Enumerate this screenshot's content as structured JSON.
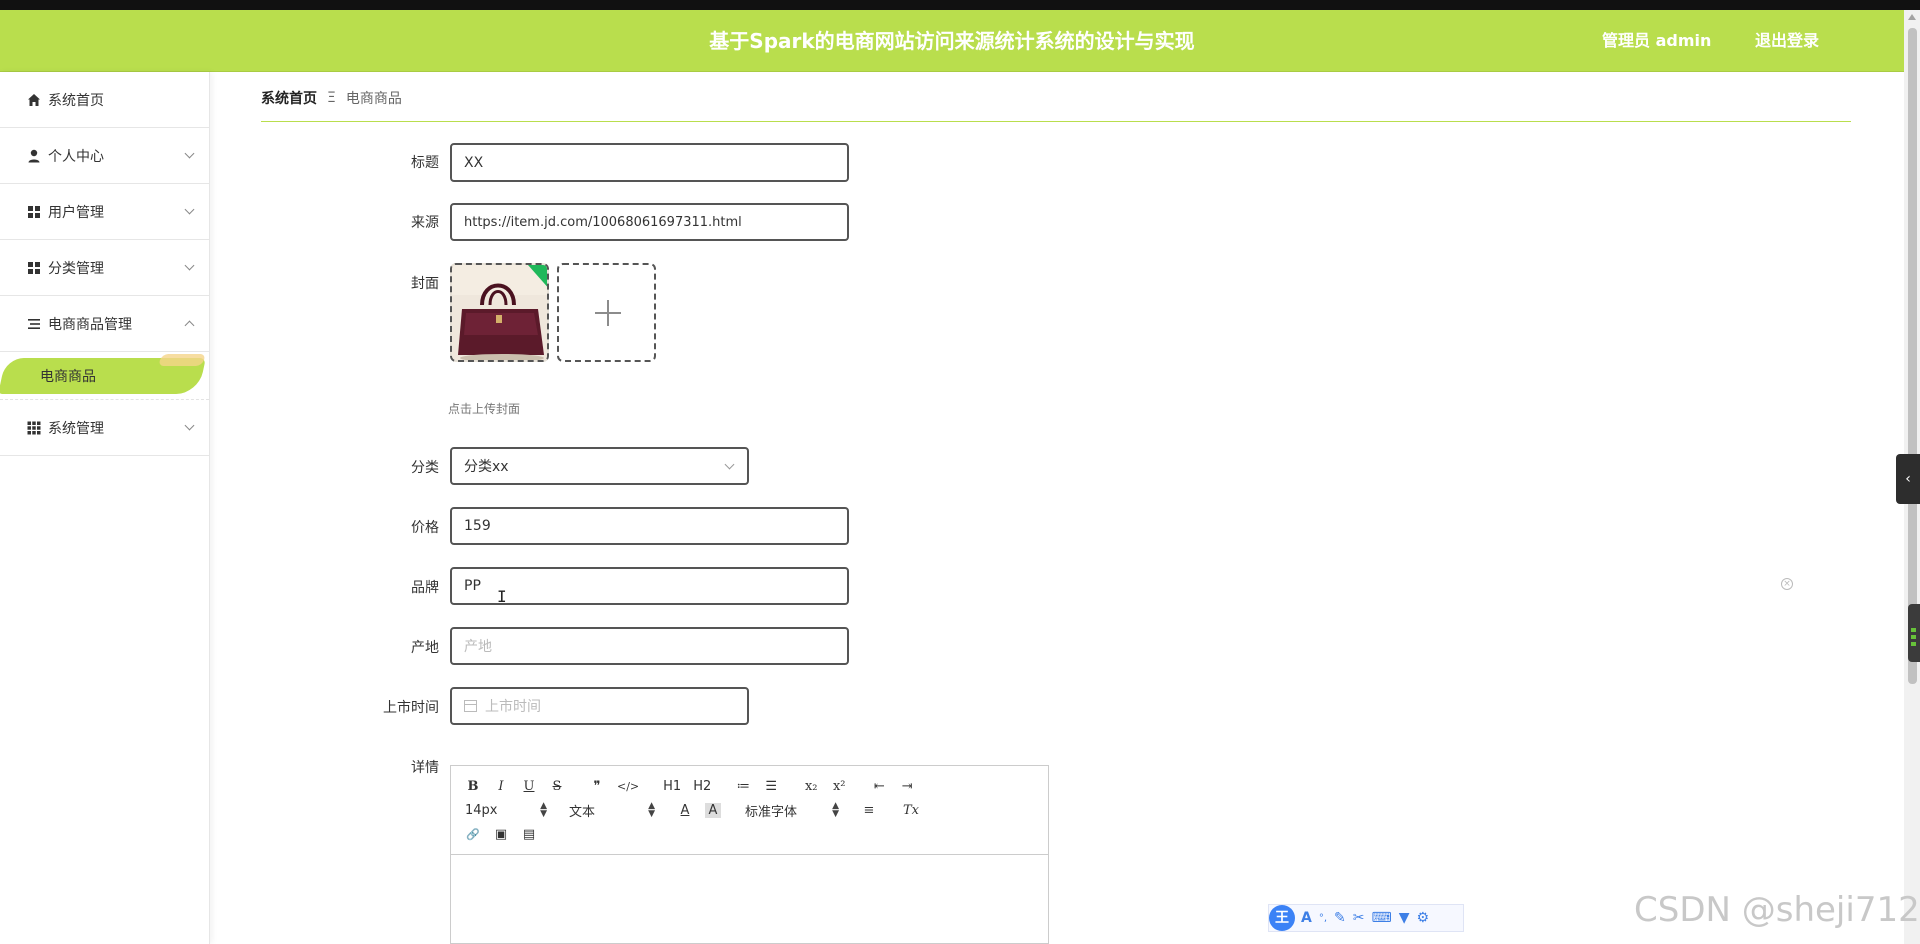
{
  "header": {
    "title": "基于Spark的电商网站访问来源统计系统的设计与实现",
    "admin": "管理员 admin",
    "logout": "退出登录",
    "bg_color": "#b9de4d"
  },
  "sidebar": {
    "items": [
      {
        "label": "系统首页",
        "icon": "home-icon"
      },
      {
        "label": "个人中心",
        "icon": "user-icon"
      },
      {
        "label": "用户管理",
        "icon": "grid-icon"
      },
      {
        "label": "分类管理",
        "icon": "grid-icon"
      },
      {
        "label": "电商商品管理",
        "icon": "list-icon"
      },
      {
        "label": "系统管理",
        "icon": "apps-icon"
      }
    ],
    "sub_items": [
      {
        "label": "电商商品"
      }
    ]
  },
  "breadcrumb": {
    "home": "系统首页",
    "separator": "Ξ",
    "current": "电商商品"
  },
  "form": {
    "title": {
      "label": "标题",
      "value": "XX"
    },
    "source": {
      "label": "来源",
      "value": "https://item.jd.com/10068061697311.html"
    },
    "cover": {
      "label": "封面",
      "hint": "点击上传封面"
    },
    "category": {
      "label": "分类",
      "value": "分类xx"
    },
    "price": {
      "label": "价格",
      "value": "159"
    },
    "brand": {
      "label": "品牌",
      "value": "PP"
    },
    "origin": {
      "label": "产地",
      "placeholder": "产地"
    },
    "launch_time": {
      "label": "上市时间",
      "placeholder": "上市时间"
    },
    "details": {
      "label": "详情"
    }
  },
  "editor": {
    "row1": [
      "B",
      "I",
      "U",
      "S",
      "❞",
      "</>",
      "H1",
      "H2",
      "≔",
      "☰",
      "x₂",
      "x²",
      "⇤",
      "⇥"
    ],
    "font_size": "14px",
    "block_type": "文本",
    "font_family": "标准字体",
    "color_a": "A",
    "bg_a": "A",
    "align": "≡",
    "clear": "Tx",
    "row3": [
      "🔗",
      "▣",
      "▤"
    ]
  },
  "watermark": "CSDN @sheji712",
  "ime_logo": "王"
}
